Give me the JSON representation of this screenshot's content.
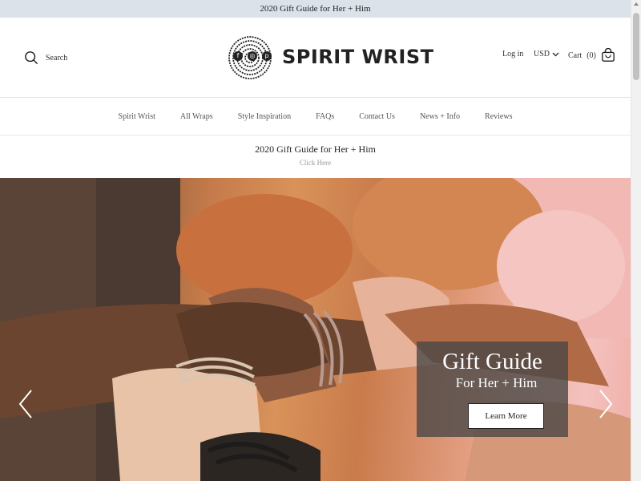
{
  "announcement": "2020 Gift Guide for Her + Him",
  "header": {
    "search_label": "Search",
    "logo_text": "SPIRIT WRIST",
    "login_label": "Log in",
    "currency": "USD",
    "cart_label": "Cart",
    "cart_count": "(0)"
  },
  "nav": {
    "items": [
      {
        "label": "Spirit Wrist"
      },
      {
        "label": "All Wraps"
      },
      {
        "label": "Style Inspiration"
      },
      {
        "label": "FAQs"
      },
      {
        "label": "Contact Us"
      },
      {
        "label": "News + Info"
      },
      {
        "label": "Reviews"
      }
    ]
  },
  "promo": {
    "title": "2020 Gift Guide for Her + Him",
    "link": "Click Here"
  },
  "hero": {
    "heading": "Gift Guide",
    "subheading": "For Her + Him",
    "button_label": "Learn More"
  },
  "icons": {
    "search": "search-icon",
    "cart": "cart-icon",
    "chevron": "chevron-down-icon",
    "facebook": "facebook-icon",
    "instagram": "instagram-icon",
    "pinterest": "pinterest-icon",
    "prev": "chevron-left-icon",
    "next": "chevron-right-icon"
  },
  "colors": {
    "announcement_bg": "#dbe2ea",
    "caption_bg": "#464646"
  }
}
